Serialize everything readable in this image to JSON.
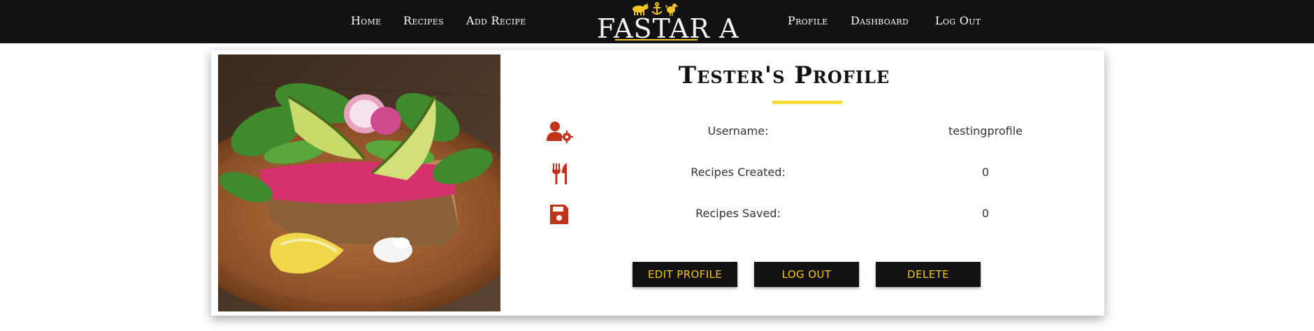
{
  "nav": {
    "left_links": [
      "Home",
      "Recipes",
      "Add Recipe"
    ],
    "right_links": [
      "Profile",
      "Dashboard",
      "Log Out"
    ],
    "brand": "FASTAR A"
  },
  "profile": {
    "title": "Tester's Profile",
    "stats": [
      {
        "icon": "user-gear-icon",
        "label": "Username:",
        "value": "testingprofile"
      },
      {
        "icon": "utensils-icon",
        "label": "Recipes Created:",
        "value": "0"
      },
      {
        "icon": "floppy-disk-icon",
        "label": "Recipes Saved:",
        "value": "0"
      }
    ],
    "buttons": [
      "EDIT PROFILE",
      "LOG OUT",
      "DELETE"
    ]
  },
  "colors": {
    "nav_bg": "#121212",
    "accent_yellow": "#f3c623",
    "icon_red": "#c0321a",
    "button_bg": "#121212"
  }
}
